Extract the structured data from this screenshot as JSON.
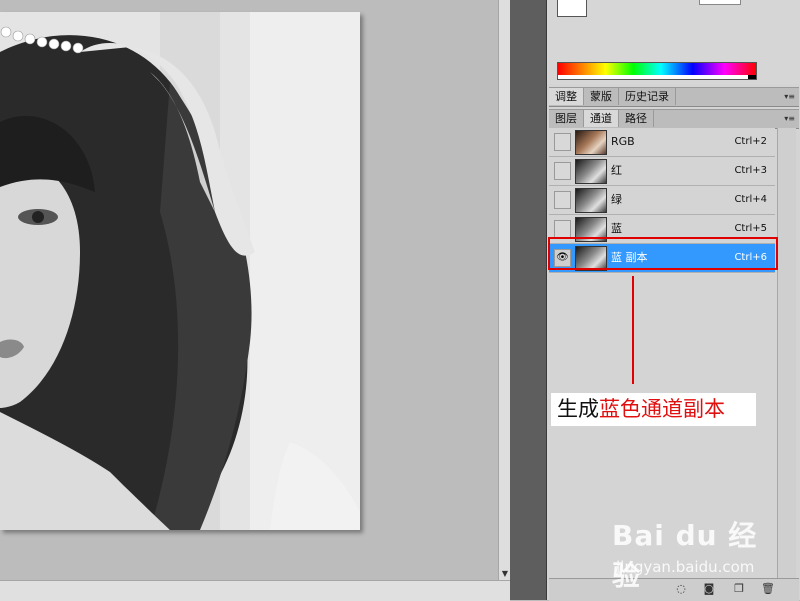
{
  "panels": {
    "tabs_top": [
      "调整",
      "蒙版",
      "历史记录"
    ],
    "tabs_channels": [
      "图层",
      "通道",
      "路径"
    ],
    "active_top_tab": "调整",
    "active_channel_tab": "通道"
  },
  "channels": [
    {
      "name": "RGB",
      "shortcut": "Ctrl+2",
      "visible": false,
      "selected": false
    },
    {
      "name": "红",
      "shortcut": "Ctrl+3",
      "visible": false,
      "selected": false
    },
    {
      "name": "绿",
      "shortcut": "Ctrl+4",
      "visible": false,
      "selected": false
    },
    {
      "name": "蓝",
      "shortcut": "Ctrl+5",
      "visible": false,
      "selected": false
    },
    {
      "name": "蓝 副本",
      "shortcut": "Ctrl+6",
      "visible": true,
      "selected": true
    }
  ],
  "annotation": {
    "prefix": "生成",
    "highlight": "蓝色通道副本"
  },
  "watermark": {
    "logo": "Bai du 经验",
    "sub": "jingyan.baidu.com"
  },
  "icons": {
    "eye": "eye-icon",
    "panel_menu": "panel-menu-icon",
    "load_selection": "load-channel-as-selection-icon",
    "save_selection": "save-selection-as-channel-icon",
    "new_channel": "new-channel-icon",
    "delete_channel": "delete-channel-icon"
  },
  "colors": {
    "selection": "#3399ff",
    "annotation_red": "#e01010"
  }
}
